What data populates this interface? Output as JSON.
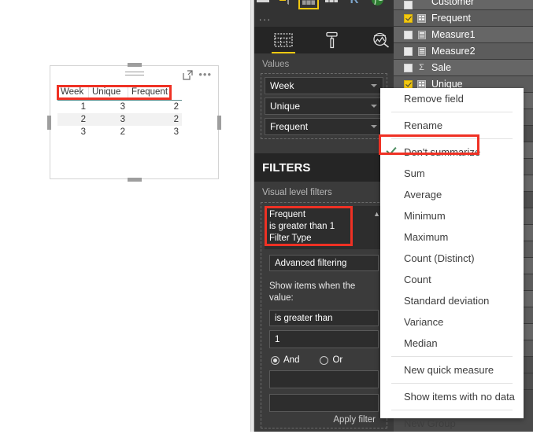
{
  "canvas": {
    "visual": {
      "title_bar": {
        "drag_handle": "drag-handle",
        "focus_icon": "focus-mode-icon",
        "more_icon": "more-options-ellipsis"
      },
      "table": {
        "columns": [
          "Week",
          "Unique",
          "Frequent"
        ],
        "rows": [
          [
            "1",
            "3",
            "2"
          ],
          [
            "2",
            "3",
            "2"
          ],
          [
            "3",
            "2",
            "3"
          ]
        ]
      },
      "annotation_color": "#ef3124"
    }
  },
  "visualizations_pane": {
    "viz_types": [
      {
        "name": "card-visual",
        "glyph": "▭"
      },
      {
        "name": "funnel-visual",
        "glyph": "▽"
      },
      {
        "name": "table-visual",
        "glyph": "▦",
        "selected": true
      },
      {
        "name": "matrix-visual",
        "glyph": "▦"
      },
      {
        "name": "r-script-visual",
        "glyph": "R"
      },
      {
        "name": "map-visual",
        "glyph": "◉"
      }
    ],
    "more_types_label": "...",
    "pane_tabs": [
      {
        "name": "fields-tab",
        "label": "Fields",
        "active": true
      },
      {
        "name": "format-tab",
        "label": "Format",
        "active": false
      },
      {
        "name": "analytics-tab",
        "label": "Analytics",
        "active": false
      }
    ],
    "wells": {
      "label": "Values",
      "fields": [
        "Week",
        "Unique",
        "Frequent"
      ]
    },
    "filters": {
      "header": "FILTERS",
      "section_label": "Visual level filters",
      "card": {
        "field": "Frequent",
        "condition": "is greater than 1",
        "type_label": "Filter Type",
        "filter_type": "Advanced filtering",
        "prompt": "Show items when the value:",
        "operator": "is greater than",
        "value": "1",
        "logic_and": "And",
        "logic_or": "Or",
        "logic_selected": "And",
        "operator2": "",
        "value2": "",
        "apply_label": "Apply filter"
      }
    }
  },
  "fields_pane": {
    "items": [
      {
        "label": "Customer",
        "checked": false,
        "icon": "field-icon",
        "glyph": "▤"
      },
      {
        "label": "Frequent",
        "checked": true,
        "icon": "date-field-icon",
        "glyph": "▦"
      },
      {
        "label": "Measure1",
        "checked": false,
        "icon": "calculator-icon",
        "glyph": "▤"
      },
      {
        "label": "Measure2",
        "checked": false,
        "icon": "calculator-icon",
        "glyph": "▤"
      },
      {
        "label": "Sale",
        "checked": false,
        "icon": "sigma-icon",
        "glyph": "Σ"
      },
      {
        "label": "Unique",
        "checked": true,
        "icon": "date-field-icon",
        "glyph": "▦"
      }
    ]
  },
  "context_menu": {
    "items": [
      {
        "label": "Remove field",
        "checked": false,
        "separator_after": true
      },
      {
        "label": "Rename",
        "checked": false,
        "separator_after": true
      },
      {
        "label": "Don't summarize",
        "checked": true,
        "separator_after": false
      },
      {
        "label": "Sum",
        "checked": false,
        "separator_after": false
      },
      {
        "label": "Average",
        "checked": false,
        "separator_after": false
      },
      {
        "label": "Minimum",
        "checked": false,
        "separator_after": false
      },
      {
        "label": "Maximum",
        "checked": false,
        "separator_after": false
      },
      {
        "label": "Count (Distinct)",
        "checked": false,
        "separator_after": false
      },
      {
        "label": "Count",
        "checked": false,
        "separator_after": false
      },
      {
        "label": "Standard deviation",
        "checked": false,
        "separator_after": false
      },
      {
        "label": "Variance",
        "checked": false,
        "separator_after": false
      },
      {
        "label": "Median",
        "checked": false,
        "separator_after": true
      },
      {
        "label": "New quick measure",
        "checked": false,
        "separator_after": true
      },
      {
        "label": "Show items with no data",
        "checked": false,
        "separator_after": true
      },
      {
        "label": "New Group",
        "checked": false,
        "separator_after": false
      }
    ],
    "annotation_color": "#ef3124"
  }
}
